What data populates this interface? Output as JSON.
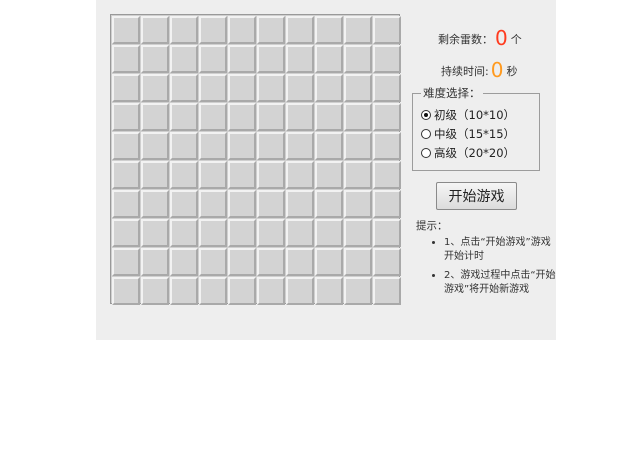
{
  "stats": {
    "mines_label": "剩余雷数：",
    "mines_value": "0",
    "mines_unit": "个",
    "time_label": "持续时间:",
    "time_value": "0",
    "time_unit": "秒"
  },
  "difficulty": {
    "legend": "难度选择：",
    "options": [
      {
        "label": "初级（10*10）",
        "checked": true
      },
      {
        "label": "中级（15*15）",
        "checked": false
      },
      {
        "label": "高级（20*20）",
        "checked": false
      }
    ]
  },
  "start_button": {
    "label": "开始游戏"
  },
  "hints": {
    "title": "提示：",
    "items": [
      "1、点击“开始游戏”游戏开始计时",
      "2、游戏过程中点击“开始游戏”将开始新游戏"
    ]
  },
  "board": {
    "rows": 10,
    "cols": 10
  },
  "colors": {
    "mines_counter": "#ff3b1f",
    "time_counter": "#ff9a1f",
    "panel_bg": "#eeeeee"
  }
}
